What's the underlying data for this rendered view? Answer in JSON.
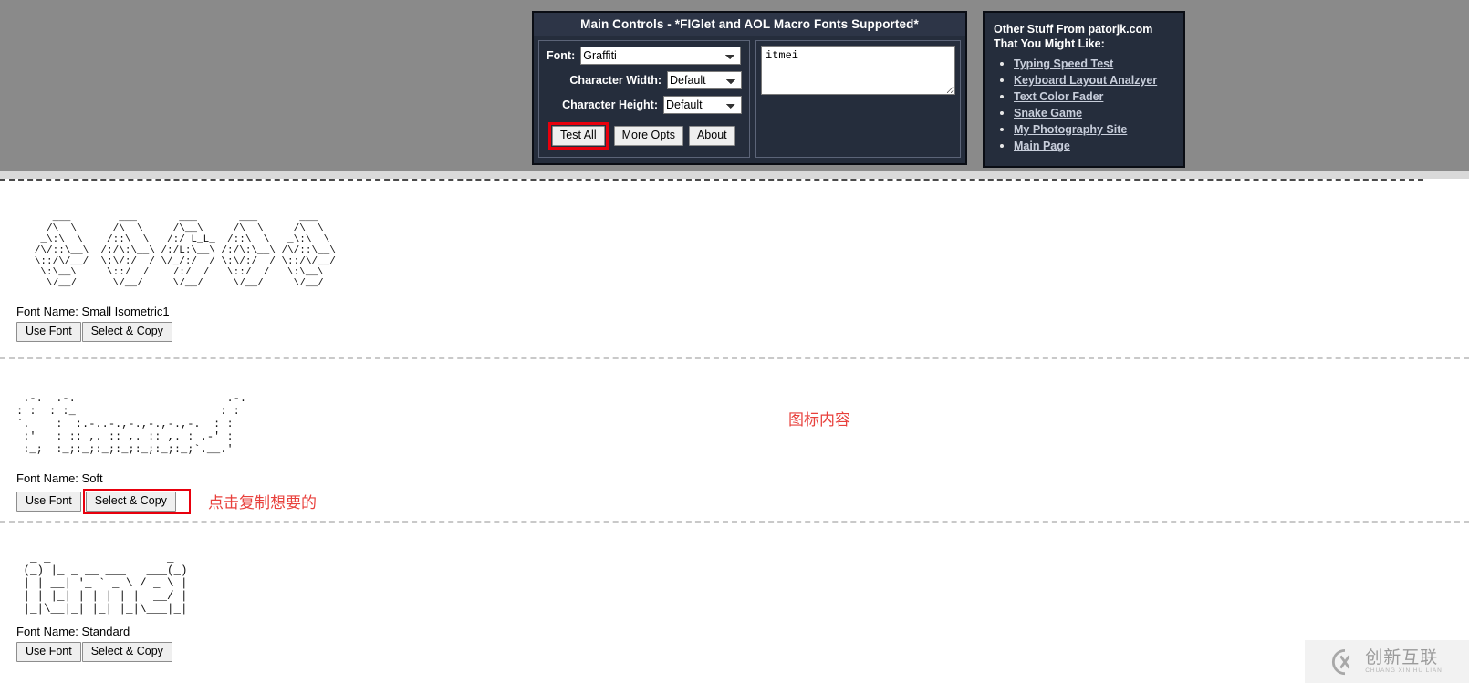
{
  "main_controls": {
    "title": "Main Controls - *FIGlet and AOL Macro Fonts Supported*",
    "font_label": "Font:",
    "font_value": "Graffiti",
    "char_width_label": "Character Width:",
    "char_width_value": "Default",
    "char_height_label": "Character Height:",
    "char_height_value": "Default",
    "buttons": {
      "test_all": "Test All",
      "more_opts": "More Opts",
      "about": "About"
    },
    "input_text": "itmei",
    "input_placeholder": ""
  },
  "other_stuff": {
    "heading_line1": "Other Stuff From patorjk.com",
    "heading_line2": "That You Might Like:",
    "links": [
      "Typing Speed Test",
      "Keyboard Layout Analzyer",
      "Text Color Fader",
      "Snake Game",
      "My Photography Site",
      "Main Page"
    ]
  },
  "results": [
    {
      "font_name_label": "Font Name: Small Isometric1",
      "use_font": "Use Font",
      "select_copy": "Select & Copy",
      "art": "      ___        ___       ___       ___       ___   \n     /\\  \\      /\\  \\     /\\__\\     /\\  \\     /\\  \\  \n    _\\:\\  \\    /::\\  \\   /:/ L_L_  /::\\  \\   _\\:\\  \\ \n   /\\/::\\__\\  /:/\\:\\__\\ /:/L:\\__\\ /:/\\:\\__\\ /\\/::\\__\\\n   \\::/\\/__/  \\:\\/:/  / \\/_/:/  / \\:\\/:/  / \\::/\\/__/\n    \\:\\__\\     \\::/  /    /:/  /   \\::/  /   \\:\\__\\  \n     \\/__/      \\/__/     \\/__/     \\/__/     \\/__/  "
    },
    {
      "font_name_label": "Font Name: Soft",
      "use_font": "Use Font",
      "select_copy": "Select & Copy",
      "art": " .-.  .-.                       .-. \n: :  : :_                      : : \n`.    :  :.-..-.,-.,-.,-.,-.  : : \n :'   : :: ,. :: ,. :: ,. : .-' :\n :_;  :_;:_;:_;:_;:_;:_;:_;`.__.'"
    },
    {
      "font_name_label": "Font Name: Standard",
      "use_font": "Use Font",
      "select_copy": "Select & Copy",
      "art": "  _ _                 _ \n (_) |_ _ __ ___   ___(_)\n | | __| '_ ` _ \\ / _ \\ |\n | | |_| | | | | |  __/ |\n |_|\\__|_| |_| |_|\\___|_|"
    }
  ],
  "annotations": {
    "copy_hint": "点击复制想要的",
    "icon_content": "图标内容"
  },
  "watermark": {
    "cn": "创新互联",
    "en": "CHUANG XIN HU LIAN"
  }
}
